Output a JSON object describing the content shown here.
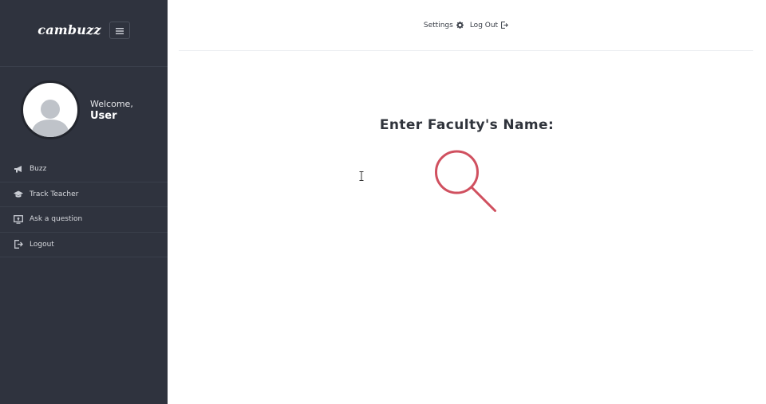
{
  "app": {
    "brand": "cambuzz"
  },
  "sidebar": {
    "welcome_label": "Welcome,",
    "user_name": "User",
    "items": [
      {
        "label": "Buzz",
        "icon": "megaphone-icon"
      },
      {
        "label": "Track Teacher",
        "icon": "graduation-cap-icon"
      },
      {
        "label": "Ask a question",
        "icon": "share-screen-icon"
      },
      {
        "label": "Logout",
        "icon": "sign-out-icon"
      }
    ]
  },
  "header": {
    "settings_label": "Settings",
    "logout_label": "Log Out"
  },
  "search": {
    "title": "Enter Faculty's Name:",
    "value": "",
    "placeholder": ""
  },
  "colors": {
    "sidebar_bg": "#2f333e",
    "accent": "#d0505f",
    "text_dark": "#30343c"
  }
}
